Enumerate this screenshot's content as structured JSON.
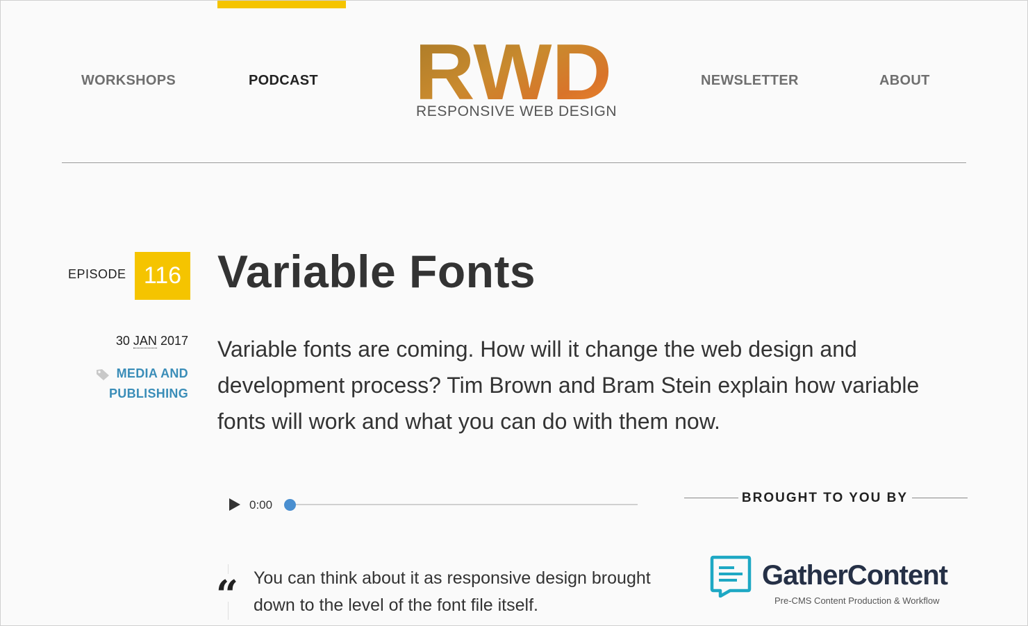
{
  "nav": {
    "items": [
      {
        "label": "WORKSHOPS",
        "active": false
      },
      {
        "label": "PODCAST",
        "active": true
      },
      {
        "label": "NEWSLETTER",
        "active": false
      },
      {
        "label": "ABOUT",
        "active": false
      }
    ]
  },
  "logo": {
    "mark": "RWD",
    "subtitle": "RESPONSIVE WEB DESIGN"
  },
  "episode": {
    "label": "EPISODE",
    "number": "116",
    "title": "Variable Fonts",
    "date_day": "30",
    "date_month": "JAN",
    "date_year": "2017",
    "category": "MEDIA AND PUBLISHING",
    "description": "Variable fonts are coming. How will it change the web design and development process? Tim Brown and Bram Stein explain how variable fonts will work and what you can do with them now."
  },
  "player": {
    "time": "0:00",
    "progress": 0
  },
  "sponsor": {
    "label": "BROUGHT TO YOU BY",
    "name": "GatherContent",
    "tagline": "Pre-CMS Content Production & Workflow"
  },
  "quote": {
    "mark": "“",
    "text": "You can think about it as responsive design brought down to the level of the font file itself."
  },
  "colors": {
    "accent": "#f5c400",
    "link": "#3a8db8",
    "progress": "#4a8fd0",
    "sponsor_icon": "#1ea8c4"
  },
  "icons": [
    "tag-icon",
    "play-icon",
    "gathercontent-logo-icon",
    "quote-icon"
  ]
}
